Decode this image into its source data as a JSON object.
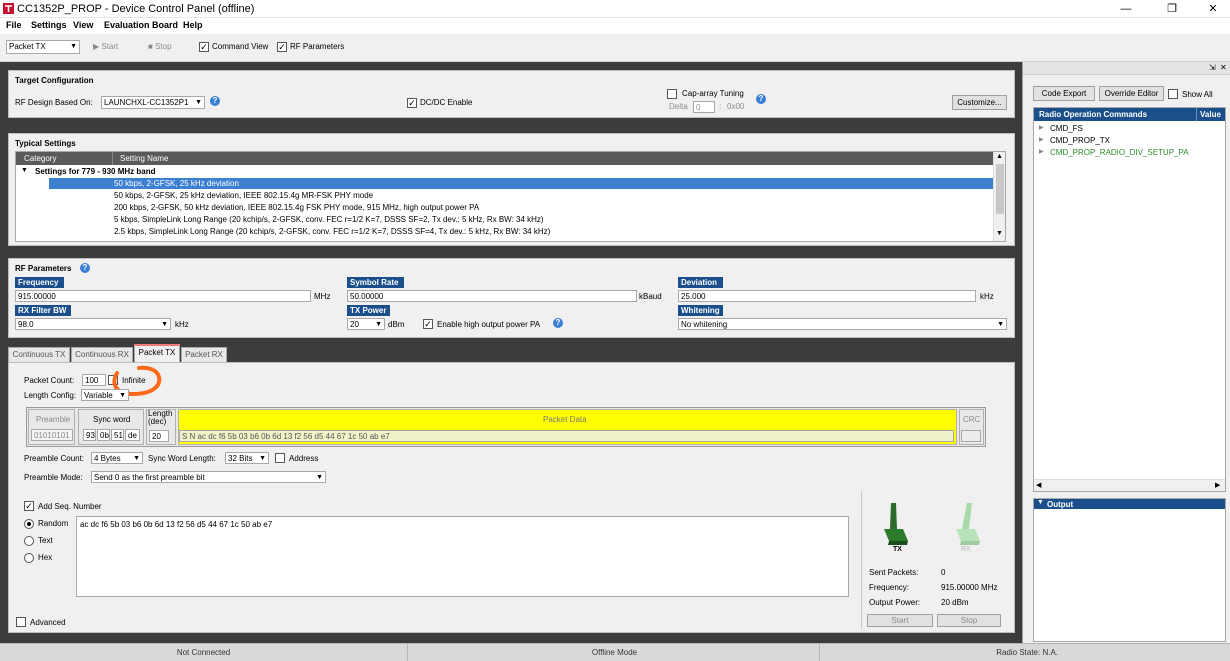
{
  "window": {
    "title": "CC1352P_PROP - Device Control Panel (offline)"
  },
  "menu": [
    "File",
    "Settings",
    "View",
    "Evaluation Board",
    "Help"
  ],
  "toolbar": {
    "mode": "Packet TX",
    "start": "Start",
    "stop": "Stop",
    "command_view": "Command View",
    "rf_parameters": "RF Parameters"
  },
  "target": {
    "title": "Target Configuration",
    "rf_design_label": "RF Design Based On:",
    "rf_design_value": "LAUNCHXL-CC1352P1",
    "dcdc": "DC/DC Enable",
    "cap_array": "Cap-array Tuning",
    "delta_label": "Delta",
    "delta_value": "0",
    "hex_value": "0x00",
    "customize": "Customize..."
  },
  "typical": {
    "title": "Typical Settings",
    "col_category": "Category",
    "col_setting": "Setting Name",
    "group": "Settings for 779 - 930 MHz band",
    "rows": [
      "50 kbps, 2-GFSK, 25 kHz deviation",
      "50 kbps, 2-GFSK, 25 kHz deviation, IEEE 802.15.4g MR-FSK PHY mode",
      "200 kbps, 2-GFSK, 50 kHz deviation, IEEE 802.15.4g FSK PHY mode, 915 MHz, high output power PA",
      "5 kbps, SimpleLink Long Range (20 kchip/s, 2-GFSK, conv. FEC r=1/2 K=7, DSSS SF=2, Tx dev.: 5 kHz, Rx BW: 34 kHz)",
      "2.5 kbps, SimpleLink Long Range (20 kchip/s, 2-GFSK, conv. FEC r=1/2 K=7, DSSS SF=4, Tx dev.: 5 kHz, Rx BW: 34 kHz)"
    ]
  },
  "rf": {
    "title": "RF Parameters",
    "frequency_label": "Frequency",
    "frequency_value": "915.00000",
    "frequency_unit": "MHz",
    "symbol_rate_label": "Symbol Rate",
    "symbol_rate_value": "50.00000",
    "symbol_rate_unit": "kBaud",
    "deviation_label": "Deviation",
    "deviation_value": "25.000",
    "deviation_unit": "kHz",
    "rx_filter_label": "RX Filter BW",
    "rx_filter_value": "98.0",
    "rx_filter_unit": "kHz",
    "tx_power_label": "TX Power",
    "tx_power_value": "20",
    "tx_power_unit": "dBm",
    "high_pa": "Enable high output power PA",
    "whitening_label": "Whitening",
    "whitening_value": "No whitening"
  },
  "tabs": [
    "Continuous TX",
    "Continuous RX",
    "Packet TX",
    "Packet RX"
  ],
  "packet": {
    "count_label": "Packet Count:",
    "count_value": "100",
    "infinite": "Infinite",
    "length_config_label": "Length Config:",
    "length_config_value": "Variable",
    "preamble_col": "Preamble",
    "preamble_value": "01010101",
    "sync_col": "Sync word",
    "sync_bytes": [
      "93",
      "0b",
      "51",
      "de"
    ],
    "length_col": "Length (dec)",
    "length_value": "20",
    "data_col": "Packet Data",
    "data_value": "S N ac dc f6 5b 03 b6 0b 6d 13 f2 56 d5 44 67 1c 50 ab e7",
    "crc_col": "CRC",
    "preamble_count_label": "Preamble Count:",
    "preamble_count_value": "4 Bytes",
    "sync_len_label": "Sync Word Length:",
    "sync_len_value": "32 Bits",
    "address": "Address",
    "preamble_mode_label": "Preamble Mode:",
    "preamble_mode_value": "Send 0 as the first preamble bit",
    "add_seq": "Add Seq. Number",
    "random": "Random",
    "text": "Text",
    "hex": "Hex",
    "payload": "ac dc f6 5b 03 b6 0b 6d 13 f2 56 d5 44 67 1c 50 ab e7",
    "advanced": "Advanced"
  },
  "txrx": {
    "tx": "TX",
    "rx": "RX",
    "sent_label": "Sent Packets:",
    "sent_value": "0",
    "freq_label": "Frequency:",
    "freq_value": "915.00000 MHz",
    "power_label": "Output Power:",
    "power_value": "20 dBm",
    "start": "Start",
    "stop": "Stop"
  },
  "right": {
    "code_export": "Code Export",
    "override_editor": "Override Editor",
    "show_all": "Show All",
    "col_commands": "Radio Operation Commands",
    "col_value": "Value",
    "commands": [
      "CMD_FS",
      "CMD_PROP_TX",
      "CMD_PROP_RADIO_DIV_SETUP_PA"
    ],
    "output": "Output"
  },
  "status": {
    "connection": "Not Connected",
    "mode": "Offline Mode",
    "radio_state": "Radio State: N.A."
  },
  "colors": {
    "accent": "#1a4f8c",
    "selection": "#3d7fd1",
    "packet_data": "#ffff00",
    "annotation": "#ff6a1a",
    "green_command": "#2e8b2e"
  }
}
